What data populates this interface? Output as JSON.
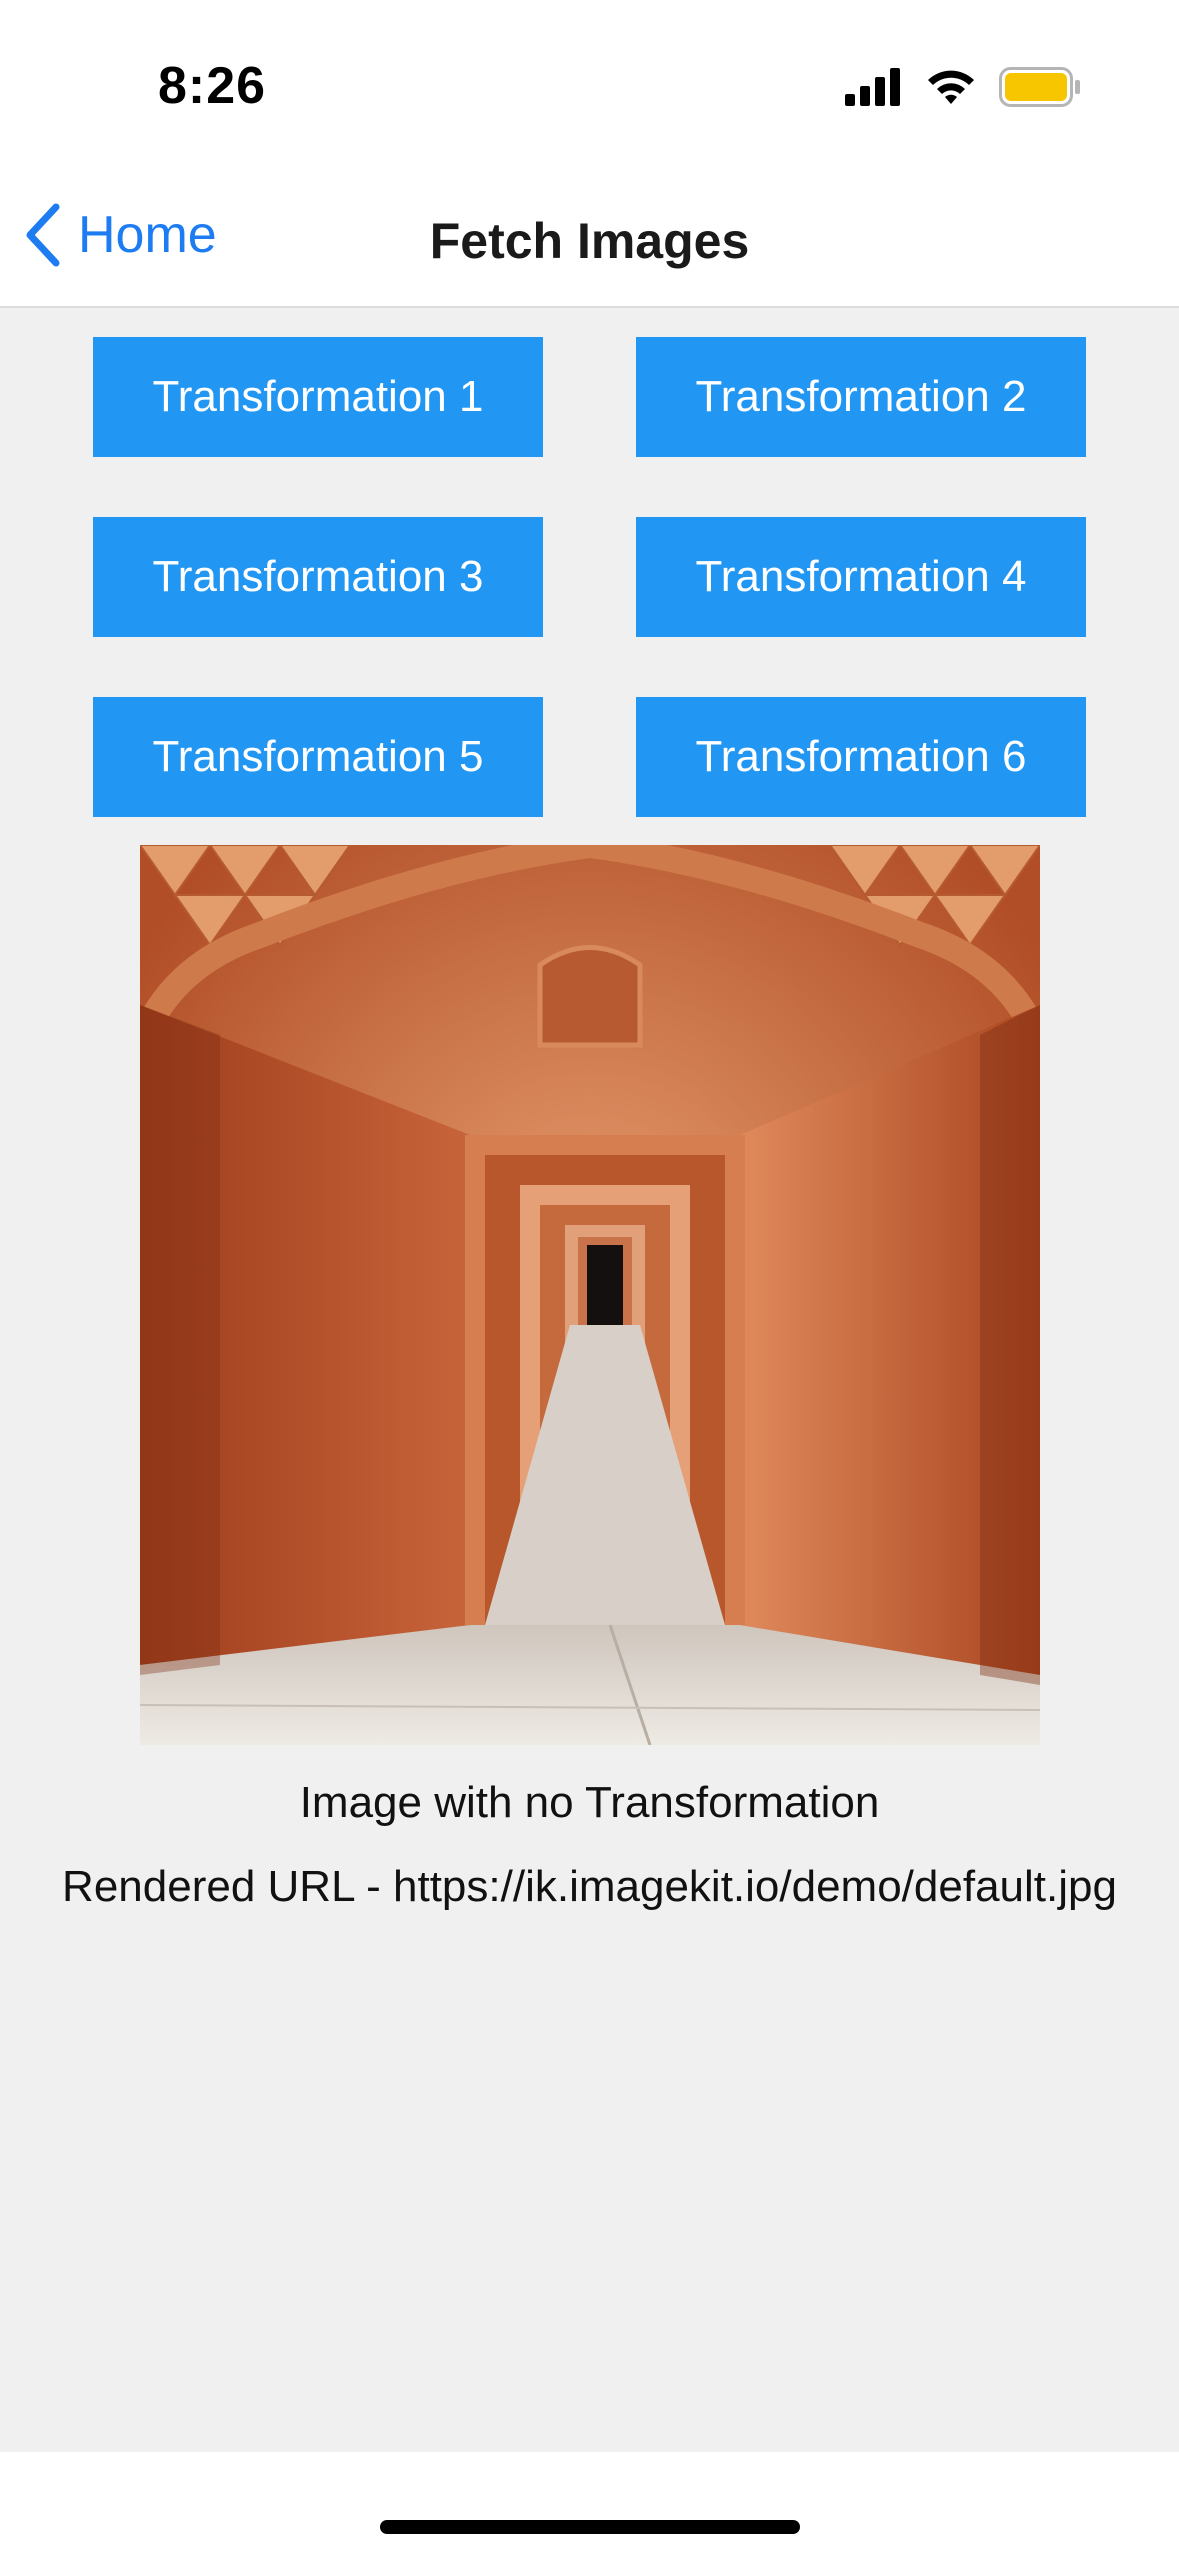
{
  "status_bar": {
    "time": "8:26",
    "icons": [
      "cellular-signal-icon",
      "wifi-icon",
      "battery-icon"
    ],
    "battery_color": "#f7c600"
  },
  "nav": {
    "back_label": "Home",
    "back_icon": "chevron-left-icon",
    "title": "Fetch Images",
    "accent": "#1e7cf2"
  },
  "buttons": [
    "Transformation 1",
    "Transformation 2",
    "Transformation 3",
    "Transformation 4",
    "Transformation 5",
    "Transformation 6"
  ],
  "button_color": "#2196f3",
  "image": {
    "subject": "orange sandstone arched corridor with successive doorways"
  },
  "caption": "Image with no Transformation",
  "rendered_url": "Rendered URL - https://ik.imagekit.io/demo/default.jpg"
}
